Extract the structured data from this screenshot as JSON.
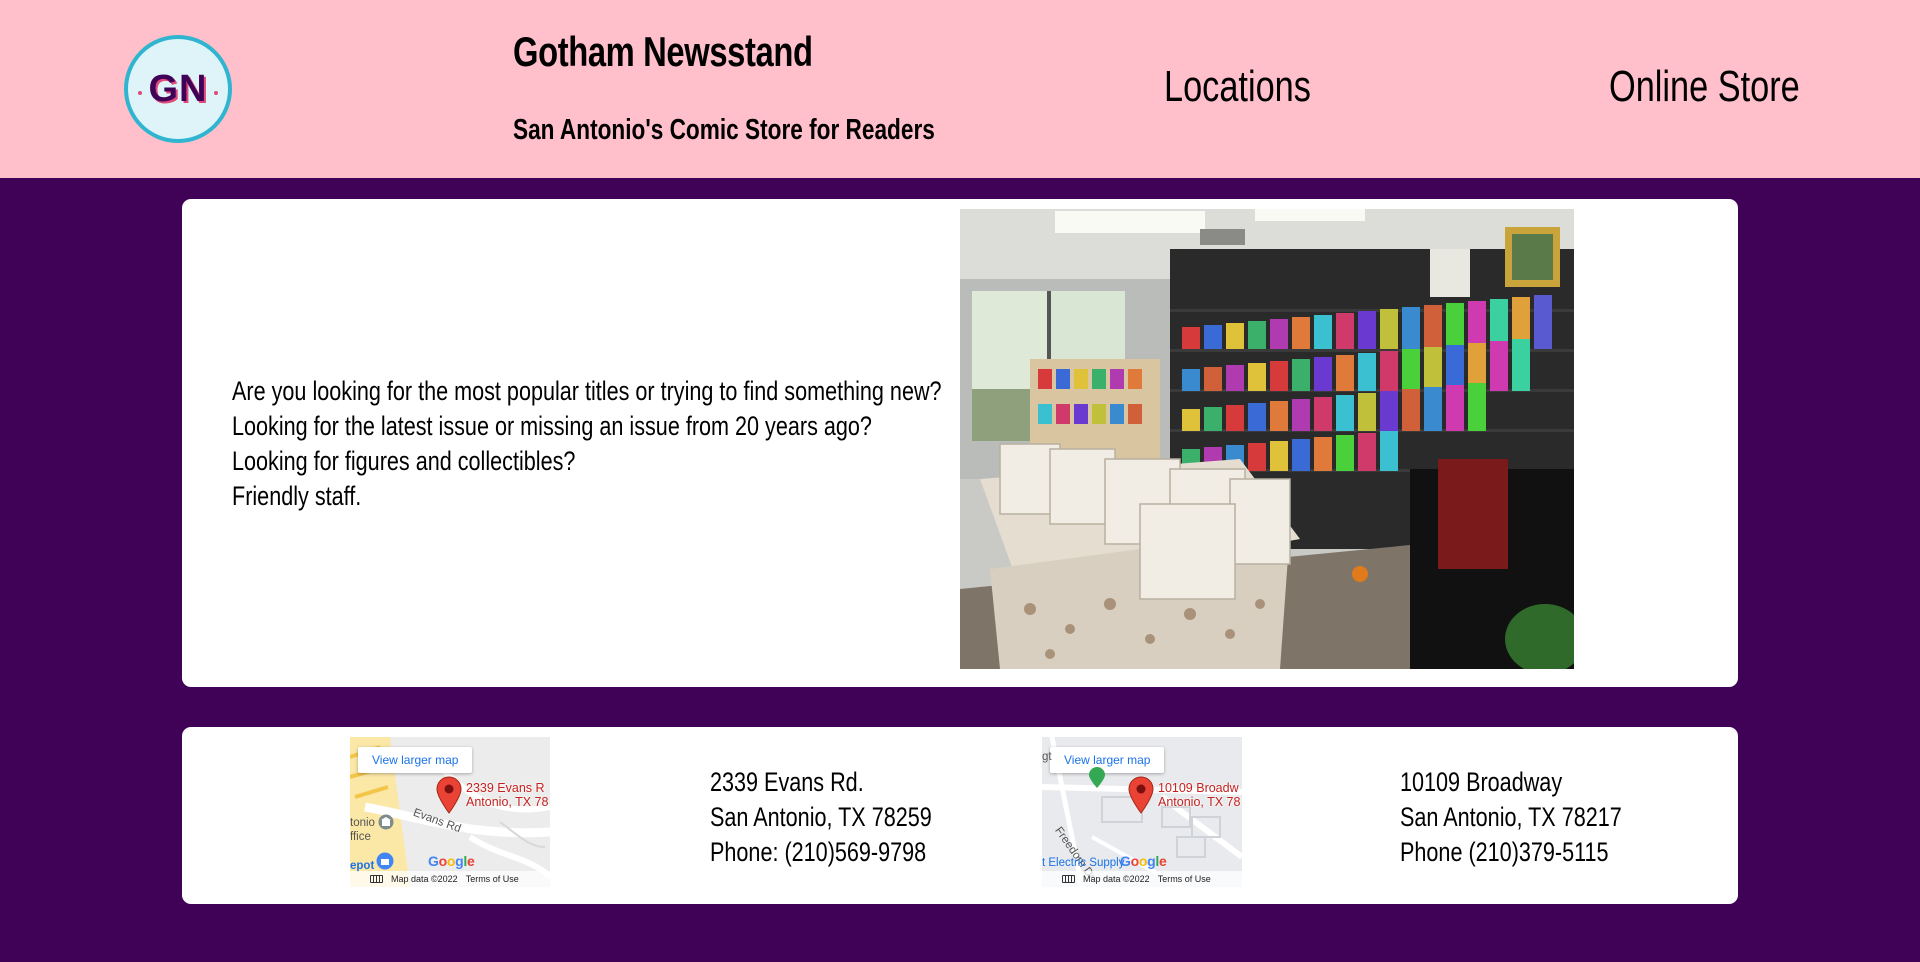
{
  "header": {
    "logo_text": "GN",
    "title": "Gotham Newsstand",
    "subtitle": "San Antonio's Comic Store for Readers",
    "nav": {
      "locations": "Locations",
      "online_store": "Online Store"
    }
  },
  "intro": {
    "lines": [
      "Are you looking for the most popular titles or trying to find something new?",
      "Looking for the latest issue or missing an issue from 20 years ago?",
      "Looking for figures and collectibles?",
      "Friendly staff."
    ]
  },
  "locations": [
    {
      "map": {
        "button": "View larger map",
        "label": "2339 Evans R\nAntonio, TX 78",
        "street_1": "Evans Rd",
        "street_2": "tonio",
        "street_3": "ffice",
        "street_4": "epot",
        "google": "Google",
        "map_data": "Map data ©2022",
        "terms": "Terms of Use"
      },
      "address": {
        "line1": "2339 Evans Rd.",
        "line2": "San Antonio, TX 78259",
        "line3": "Phone: (210)569-9798"
      }
    },
    {
      "map": {
        "button": "View larger map",
        "label": "10109 Broadw\nAntonio, TX 78",
        "street_1": "Freedom Dr",
        "street_2": "gt",
        "street_3": "t Electric Supply",
        "google": "Google",
        "map_data": "Map data ©2022",
        "terms": "Terms of Use"
      },
      "address": {
        "line1": "10109 Broadway",
        "line2": "San Antonio, TX 78217",
        "line3": "Phone (210)379-5115"
      }
    }
  ],
  "colors": {
    "header_bg": "#ffbfcb",
    "page_bg": "#3f0257",
    "logo_ring": "#2fb5cf",
    "logo_text": "#3f0257",
    "map_pin": "#ea4335"
  }
}
